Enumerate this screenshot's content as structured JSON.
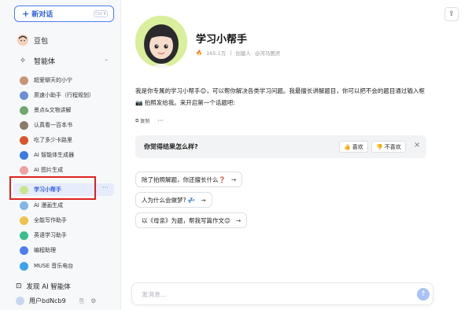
{
  "sidebar": {
    "new_chat_label": "新对话",
    "shortcut": "Ctrl K",
    "doubao_label": "豆包",
    "agents_label": "智能体",
    "agents": [
      {
        "label": "超爱聊天的小宁",
        "color": "#c89478"
      },
      {
        "label": "质速小助手（行程规划）",
        "color": "#6c8fd8"
      },
      {
        "label": "景点&文物讲解",
        "color": "#6fa86b"
      },
      {
        "label": "认真看一百本书",
        "color": "#8a7b6a"
      },
      {
        "label": "吃了多少卡路里",
        "color": "#d9542d"
      },
      {
        "label": "AI 智能体生成器",
        "color": "#3a7be0"
      },
      {
        "label": "AI 图片生成",
        "color": "#f0a3a3"
      },
      {
        "label": "学习小帮手",
        "color": "#c7e98c"
      },
      {
        "label": "AI 漫画生成",
        "color": "#7fb6e6"
      },
      {
        "label": "全能写作助手",
        "color": "#f2c34a"
      },
      {
        "label": "英语学习助手",
        "color": "#3bbd8c"
      },
      {
        "label": "编程助理",
        "color": "#4d7cf5"
      },
      {
        "label": "MUSE 音乐电台",
        "color": "#3aa3ee"
      }
    ],
    "more_label": "···",
    "discover_label": "发现 AI 智能体",
    "user_label": "用户bdNcb9"
  },
  "bot": {
    "name": "学习小帮手",
    "heat": "165.1万",
    "creator_label": "创建人",
    "creator": "@河马图灵"
  },
  "message": {
    "intro": "我是你专属的学习小帮手😊，可以帮你解决各类学习问题。我最擅长讲解题目，你可以把不会的题目通过输入框 📷 拍照发给我。来开启第一个话题吧:",
    "copy_label": "复制",
    "more": "···"
  },
  "feedback": {
    "question": "你觉得结果怎么样?",
    "like_label": "喜欢",
    "dislike_label": "不喜欢",
    "close": "×"
  },
  "suggestions": [
    "除了拍照解题，你还擅长什么❓",
    "人为什么会做梦? 💤",
    "以《母亲》为题，帮我写篇作文😊"
  ],
  "composer": {
    "placeholder": "发消息..."
  },
  "colors": {
    "accent": "#2f62e8",
    "highlight_box": "#e0221f",
    "avatar_bg": "#d9ef9b"
  }
}
